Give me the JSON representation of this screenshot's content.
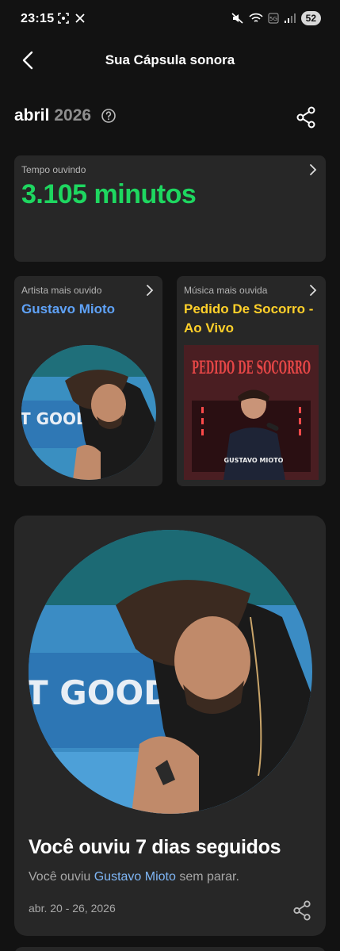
{
  "status_bar": {
    "time": "23:15",
    "battery": "52"
  },
  "header": {
    "title": "Sua Cápsula sonora"
  },
  "period": {
    "month": "abril",
    "year": "2026"
  },
  "listening_time": {
    "label": "Tempo ouvindo",
    "value": "3.105 minutos"
  },
  "top_artist": {
    "label": "Artista mais ouvido",
    "name": "Gustavo Mioto"
  },
  "top_song": {
    "label": "Música mais ouvida",
    "name": "Pedido De Socorro - Ao Vivo",
    "cover_title": "PEDIDO DE SOCORRO",
    "cover_artist": "GUSTAVO MIOTO"
  },
  "streak": {
    "title": "Você ouviu 7 dias seguidos",
    "sub_prefix": "Você ouviu ",
    "sub_artist": "Gustavo Mioto",
    "sub_suffix": " sem parar.",
    "date_range": "abr. 20 - 26, 2026"
  },
  "artist_photo": {
    "wall_text": "T GOODBYE"
  },
  "colors": {
    "background": "#121212",
    "card": "#272727",
    "green": "#1ed760",
    "artist_blue": "#5fa2f7",
    "song_yellow": "#ffd02a"
  }
}
